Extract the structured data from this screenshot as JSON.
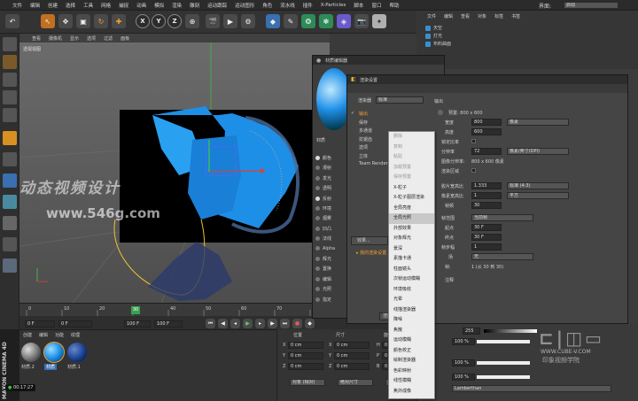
{
  "menubar": {
    "items": [
      "文件",
      "编辑",
      "创建",
      "选择",
      "工具",
      "网格",
      "捕捉",
      "动画",
      "模拟",
      "渲染",
      "雕刻",
      "运动跟踪",
      "运动图形",
      "角色",
      "流水线",
      "插件",
      "X-Particles",
      "脚本",
      "窗口",
      "帮助"
    ],
    "layout_label": "界面:",
    "layout_value": "启动"
  },
  "toolbar": {
    "axis_x": "X",
    "axis_y": "Y",
    "axis_z": "Z"
  },
  "viewport": {
    "menu": [
      "查看",
      "摄像机",
      "显示",
      "选项",
      "过滤",
      "面板"
    ],
    "name": "透视视图",
    "watermark_cn": "动态视频设计",
    "watermark_url": "www.546g.com"
  },
  "timeline": {
    "ticks": [
      "0",
      "10",
      "20",
      "30",
      "40",
      "50",
      "60",
      "70",
      "80"
    ],
    "current_frame": "0 F",
    "field_start": "0 F",
    "field_end": "100 F",
    "field_end2": "100 F",
    "marker_frame": "30"
  },
  "material_panel": {
    "menu": [
      "创建",
      "编辑",
      "功能",
      "纹理"
    ],
    "materials": [
      "材质.2",
      "材质",
      "材质.1"
    ],
    "timer": "00:17:27",
    "logo": "MAXON CINEMA 4D"
  },
  "coords": {
    "headers": [
      "位置",
      "尺寸",
      "旋转"
    ],
    "rows": [
      {
        "axis": "X",
        "pos": "0 cm",
        "size": "0 cm",
        "rot_axis": "H",
        "rot": "0 °"
      },
      {
        "axis": "Y",
        "pos": "0 cm",
        "size": "0 cm",
        "rot_axis": "P",
        "rot": "0 °"
      },
      {
        "axis": "Z",
        "pos": "0 cm",
        "size": "0 cm",
        "rot_axis": "B",
        "rot": "0 °"
      }
    ],
    "mode_a": "对象 (相对)",
    "mode_b": "绝对尺寸",
    "apply": "应用"
  },
  "object_manager": {
    "menu": [
      "文件",
      "编辑",
      "查看",
      "对象",
      "标签",
      "书签"
    ],
    "objects": [
      "天空",
      "灯光",
      "布料曲面"
    ]
  },
  "material_editor": {
    "title": "材质编辑器",
    "mat_label": "材质",
    "channels": [
      {
        "name": "颜色",
        "on": true
      },
      {
        "name": "漫射",
        "on": false
      },
      {
        "name": "发光",
        "on": false
      },
      {
        "name": "透明",
        "on": false
      },
      {
        "name": "反射",
        "on": true
      },
      {
        "name": "环境",
        "on": false
      },
      {
        "name": "烟雾",
        "on": false
      },
      {
        "name": "凹凸",
        "on": false
      },
      {
        "name": "法线",
        "on": false
      },
      {
        "name": "Alpha",
        "on": false
      },
      {
        "name": "辉光",
        "on": false
      },
      {
        "name": "置换",
        "on": false
      },
      {
        "name": "编辑",
        "on": false
      },
      {
        "name": "光照",
        "on": false
      },
      {
        "name": "指定",
        "on": false
      }
    ]
  },
  "render_settings": {
    "title": "渲染设置",
    "renderer_label": "渲染器",
    "renderer_value": "标准",
    "nav": [
      {
        "label": "输出",
        "checked": true
      },
      {
        "label": "保存",
        "checked": false
      },
      {
        "label": "多通道",
        "checked": false
      },
      {
        "label": "抗锯齿",
        "checked": false
      },
      {
        "label": "选项",
        "checked": false
      },
      {
        "label": "立体",
        "checked": false
      },
      {
        "label": "Team Render",
        "checked": false
      }
    ],
    "section": "输出",
    "preset": "预置: 800 x 600",
    "width_label": "宽度",
    "width_value": "800",
    "width_unit": "像素",
    "height_label": "高度",
    "height_value": "600",
    "lock_label": "锁定比率",
    "res_label": "分辨率",
    "res_value": "72",
    "res_unit": "像素/英寸(DPI)",
    "img_res_label": "图像分辨率:",
    "img_res_value": "800 x 600 像素",
    "region_label": "渲染区域",
    "film_label": "胶片宽高比",
    "film_value": "1.333",
    "film_unit": "标准 (4:3)",
    "pixel_label": "像素宽高比",
    "pixel_value": "1",
    "pixel_unit": "平方",
    "fps_label": "帧频",
    "fps_value": "30",
    "range_label": "帧范围",
    "range_value": "当前帧",
    "start_label": "起点",
    "start_value": "30 F",
    "end_label": "终点",
    "end_value": "30 F",
    "step_label": "帧步幅",
    "step_value": "1",
    "field_label": "场",
    "field_value": "无",
    "frames_label": "帧:",
    "frames_value": "1 (从 30 到 30)",
    "note_label": "注释",
    "effects_btn": "效果...",
    "myrender": "我的渲染设置",
    "render_btn": "渲染设置..."
  },
  "context_menu": {
    "items": [
      {
        "label": "删除",
        "state": "dim"
      },
      {
        "label": "复制",
        "state": "dim"
      },
      {
        "label": "粘贴",
        "state": "dim"
      },
      {
        "label": "加载预置",
        "state": "dim"
      },
      {
        "label": "保存预置",
        "state": "dim"
      },
      {
        "label": "X-粒子",
        "state": "normal"
      },
      {
        "label": "X-粒子图层渲染",
        "state": "normal"
      },
      {
        "label": "全局亮度",
        "state": "normal"
      },
      {
        "label": "全局光照",
        "state": "hl"
      },
      {
        "label": "外部效果",
        "state": "normal"
      },
      {
        "label": "对象辉光",
        "state": "normal"
      },
      {
        "label": "景深",
        "state": "normal"
      },
      {
        "label": "素描卡通",
        "state": "normal"
      },
      {
        "label": "柱面镜头",
        "state": "normal"
      },
      {
        "label": "次帧运动模糊",
        "state": "normal"
      },
      {
        "label": "环境吸收",
        "state": "normal"
      },
      {
        "label": "光晕",
        "state": "normal"
      },
      {
        "label": "线描渲染器",
        "state": "normal"
      },
      {
        "label": "降噪",
        "state": "normal"
      },
      {
        "label": "焦散",
        "state": "normal"
      },
      {
        "label": "运动模糊",
        "state": "normal"
      },
      {
        "label": "颜色校正",
        "state": "normal"
      },
      {
        "label": "绘制渲染器",
        "state": "normal"
      },
      {
        "label": "色彩映射",
        "state": "normal"
      },
      {
        "label": "线性模糊",
        "state": "normal"
      },
      {
        "label": "焦外成像",
        "state": "normal"
      }
    ]
  },
  "attributes": {
    "val_255": "255",
    "pct1": "100 %",
    "pct2": "100 %",
    "pct3": "100 %",
    "shader": "Lamberthan"
  },
  "cube_watermark": {
    "url": "WWW.CUBE-V.COM",
    "cn": "印象视频学院"
  },
  "colors": {
    "accent_orange": "#f0a030",
    "cloth_blue": "#1e8fe6",
    "viewport_bg": "#5e5e5e"
  }
}
